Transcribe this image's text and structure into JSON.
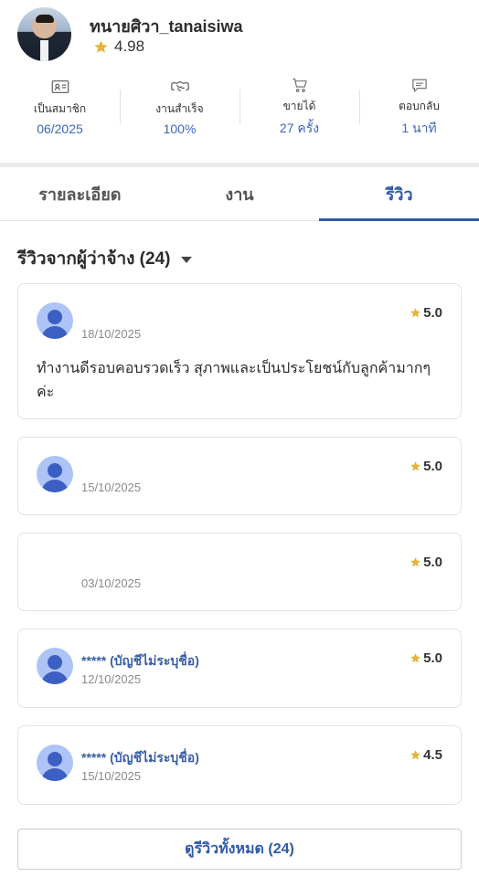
{
  "profile": {
    "username": "ทนายศิวา_tanaisiwa",
    "rating": "4.98"
  },
  "stats": [
    {
      "icon": "id-card-icon",
      "label": "เป็นสมาชิก",
      "value": "06/2025"
    },
    {
      "icon": "handshake-icon",
      "label": "งานสำเร็จ",
      "value": "100%"
    },
    {
      "icon": "cart-icon",
      "label": "ขายได้",
      "value": "27 ครั้ง"
    },
    {
      "icon": "chat-icon",
      "label": "ตอบกลับ",
      "value": "1 นาที"
    }
  ],
  "tabs": [
    {
      "label": "รายละเอียด",
      "active": false
    },
    {
      "label": "งาน",
      "active": false
    },
    {
      "label": "รีวิว",
      "active": true
    }
  ],
  "reviews_section": {
    "title": "รีวิวจากผู้ว่าจ้าง (24)"
  },
  "reviews": [
    {
      "name": "",
      "date": "18/10/2025",
      "score": "5.0",
      "text": "ทำงานดีรอบคอบรวดเร็ว สุภาพและเป็นประโยชน์กับลูกค้ามากๆ ค่ะ",
      "show_avatar": true
    },
    {
      "name": "",
      "date": "15/10/2025",
      "score": "5.0",
      "text": "",
      "show_avatar": true
    },
    {
      "name": "",
      "date": "03/10/2025",
      "score": "5.0",
      "text": "",
      "show_avatar": false
    },
    {
      "name": "***** (บัญชีไม่ระบุชื่อ)",
      "date": "12/10/2025",
      "score": "5.0",
      "text": "",
      "show_avatar": true
    },
    {
      "name": "***** (บัญชีไม่ระบุชื่อ)",
      "date": "15/10/2025",
      "score": "4.5",
      "text": "",
      "show_avatar": true
    }
  ],
  "view_all": {
    "label": "ดูรีวิวทั้งหมด (24)"
  },
  "colors": {
    "accent": "#2f5aa8",
    "stat_value": "#3d67b5",
    "star": "#e2b43a",
    "avatar_bg": "#aec4f6",
    "avatar_fg": "#3b5fc2"
  }
}
